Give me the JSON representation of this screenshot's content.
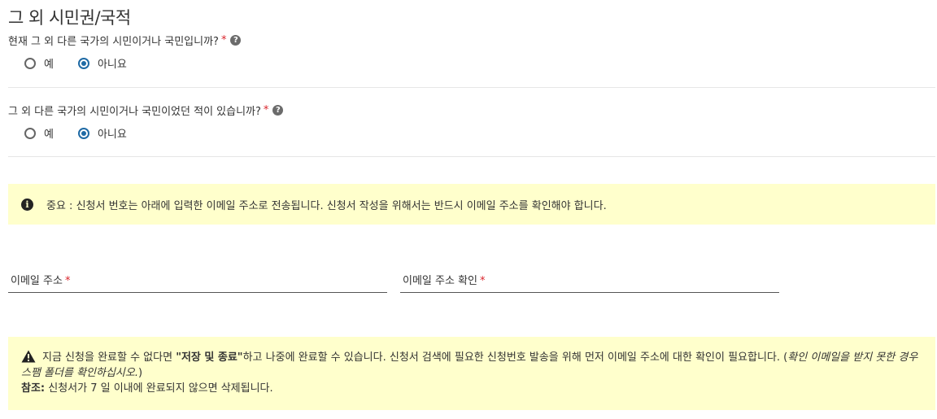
{
  "section": {
    "title": "그 외 시민권/국적"
  },
  "questions": [
    {
      "label": "현재 그 외 다른 국가의 시민이거나 국민입니까?",
      "required_mark": "*",
      "help": "?",
      "options": [
        {
          "label": "예",
          "checked": false
        },
        {
          "label": "아니요",
          "checked": true
        }
      ]
    },
    {
      "label": "그 외 다른 국가의 시민이거나 국민이었던 적이 있습니까?",
      "required_mark": "*",
      "help": "?",
      "options": [
        {
          "label": "예",
          "checked": false
        },
        {
          "label": "아니요",
          "checked": true
        }
      ]
    }
  ],
  "info_notice": {
    "icon": "info-circle-icon",
    "icon_glyph": "i",
    "text": "중요 : 신청서 번호는 아래에 입력한 이메일 주소로 전송됩니다. 신청서 작성을 위해서는 반드시 이메일 주소를 확인해야 합니다."
  },
  "fields": {
    "email": {
      "label": "이메일 주소",
      "required_mark": "*",
      "value": ""
    },
    "email_confirm": {
      "label": "이메일 주소 확인",
      "required_mark": "*",
      "value": ""
    }
  },
  "warning_notice": {
    "icon": "warning-triangle-icon",
    "text_before": "지금 신청을 완료할 수 없다면 ",
    "bold_action": "\"저장 및 종료\"",
    "text_after": "하고 나중에 완료할 수 있습니다. 신청서 검색에 필요한 신청번호 발송을 위해 먼저 이메일 주소에 대한 확인이 필요합니다. (",
    "italic_note": "확인 이메일을 받지 못한 경우 스팸 폴더를 확인하십시오.",
    "text_close": ")",
    "note_label": "참조:",
    "note_text": " 신청서가 7 일 이내에 완료되지 않으면 삭제됩니다."
  },
  "colors": {
    "notice_bg": "#ffffcc",
    "radio_checked": "#1f6aa5",
    "required": "#d9242b"
  }
}
